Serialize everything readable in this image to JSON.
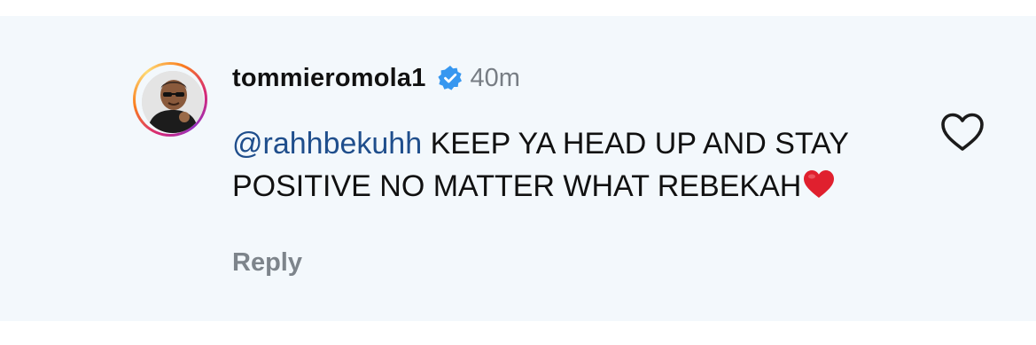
{
  "comment": {
    "username": "tommieromola1",
    "time_ago": "40m",
    "mention": "@rahhbekuhh",
    "text": " KEEP YA HEAD UP AND STAY POSITIVE NO MATTER WHAT REBEKAH",
    "reply_label": "Reply",
    "verified_icon": "verified-badge-icon",
    "like_icon": "heart-outline-icon",
    "emoji_icon": "red-heart-emoji"
  },
  "colors": {
    "background": "#f3f8fc",
    "mention": "#1f4e8c",
    "verified": "#3797f0",
    "muted_text": "#7d848b",
    "emoji_red": "#e0202e"
  }
}
